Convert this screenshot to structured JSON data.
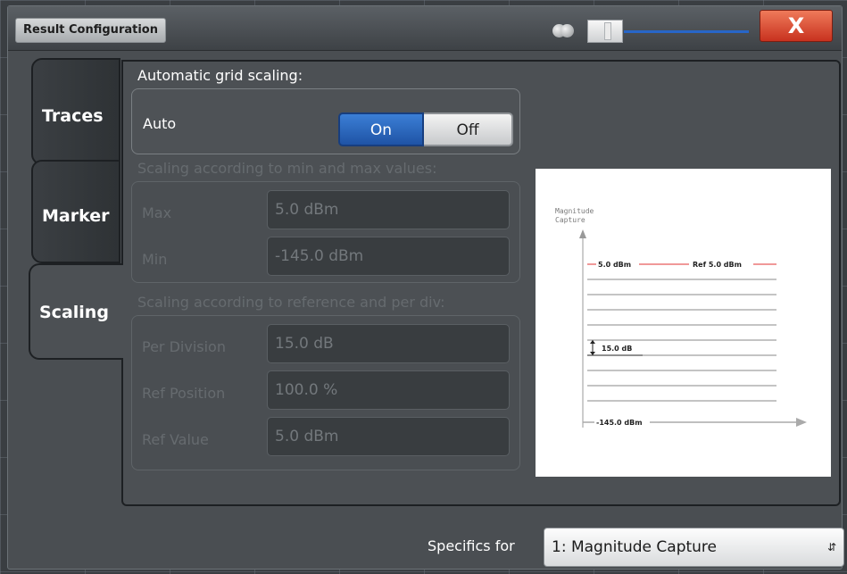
{
  "window": {
    "title": "Result Configuration",
    "close_label": "X"
  },
  "tabs": [
    {
      "label": "Traces"
    },
    {
      "label": "Marker"
    },
    {
      "label": "Scaling"
    }
  ],
  "active_tab": "Scaling",
  "auto_section": {
    "heading": "Automatic grid scaling:",
    "auto_label": "Auto",
    "on_label": "On",
    "off_label": "Off",
    "selected": "On"
  },
  "minmax_section": {
    "heading": "Scaling according to min and max values:",
    "max_label": "Max",
    "max_value": "5.0 dBm",
    "min_label": "Min",
    "min_value": "-145.0 dBm"
  },
  "refdiv_section": {
    "heading": "Scaling according to reference and per div:",
    "per_division_label": "Per Division",
    "per_division_value": "15.0 dB",
    "ref_position_label": "Ref Position",
    "ref_position_value": "100.0 %",
    "ref_value_label": "Ref Value",
    "ref_value_value": "5.0 dBm"
  },
  "diagram": {
    "axis_label_line1": "Magnitude",
    "axis_label_line2": "Capture",
    "top_value": "5.0 dBm",
    "ref_label": "Ref 5.0 dBm",
    "div_label": "15.0 dB",
    "bottom_value": "-145.0 dBm",
    "ref_line_color": "#e03030"
  },
  "footer": {
    "specifics_label": "Specifics for",
    "specifics_value": "1: Magnitude Capture"
  },
  "colors": {
    "accent_blue": "#2a64c4",
    "close_red": "#d8442c"
  }
}
